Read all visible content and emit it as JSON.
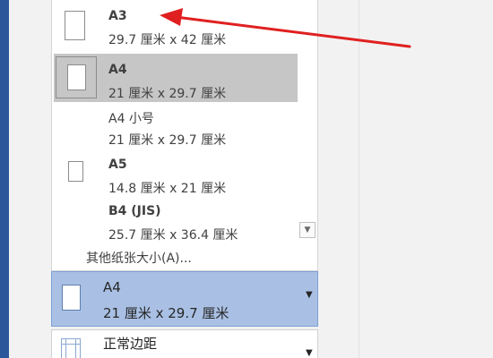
{
  "paper_sizes": [
    {
      "name": "A3",
      "dimensions": "29.7 厘米 x 42 厘米",
      "selected": false
    },
    {
      "name": "A4",
      "dimensions": "21 厘米 x 29.7 厘米",
      "selected": true
    },
    {
      "name": "A4 小号",
      "dimensions": "21 厘米 x 29.7 厘米",
      "selected": false
    },
    {
      "name": "A5",
      "dimensions": "14.8 厘米 x 21 厘米",
      "selected": false
    },
    {
      "name": "B4 (JIS)",
      "dimensions": "25.7 厘米 x 36.4 厘米",
      "selected": false
    }
  ],
  "more_sizes_label": "其他纸张大小(A)...",
  "current_size": {
    "name": "A4",
    "dimensions": "21 厘米 x 29.7 厘米"
  },
  "margins": {
    "label": "正常边距"
  },
  "icons": {
    "dropdown": "chevron-down-icon",
    "page": "page-icon",
    "margins": "margins-icon",
    "annotation": "red-arrow-icon"
  },
  "colors": {
    "selected_item": "#c6c6c6",
    "current_size_bg": "#a9c0e4",
    "app_accent": "#2b579a",
    "annotation_arrow": "#e02020"
  }
}
